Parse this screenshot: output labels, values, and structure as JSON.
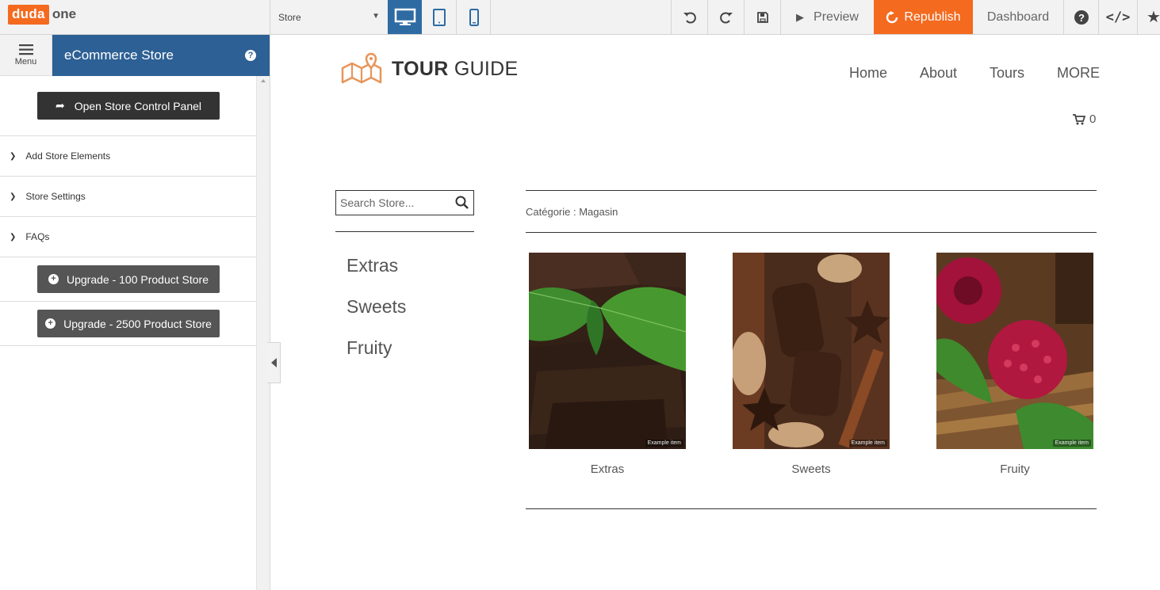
{
  "app": {
    "logo_brand": "duda",
    "logo_suffix": "one",
    "page_select": "Store",
    "preview_label": "Preview",
    "republish_label": "Republish",
    "dashboard_label": "Dashboard",
    "accent_color": "#f46a1f",
    "active_device_color": "#2e6ba3"
  },
  "sidebar": {
    "menu_label": "Menu",
    "title": "eCommerce Store",
    "open_panel_label": "Open Store Control Panel",
    "sections": [
      {
        "label": "Add Store Elements"
      },
      {
        "label": "Store Settings"
      },
      {
        "label": "FAQs"
      }
    ],
    "upgrades": [
      {
        "label": "Upgrade - 100 Product Store"
      },
      {
        "label": "Upgrade - 2500 Product Store"
      }
    ]
  },
  "site": {
    "logo_bold": "TOUR",
    "logo_light": " GUIDE",
    "nav": [
      "Home",
      "About",
      "Tours",
      "MORE"
    ],
    "cart_count": "0",
    "search_placeholder": "Search Store...",
    "categories": [
      "Extras",
      "Sweets",
      "Fruity"
    ],
    "breadcrumb": "Catégorie : Magasin",
    "products": [
      {
        "name": "Extras",
        "tag": "Example item"
      },
      {
        "name": "Sweets",
        "tag": "Example item"
      },
      {
        "name": "Fruity",
        "tag": "Example item"
      }
    ]
  }
}
